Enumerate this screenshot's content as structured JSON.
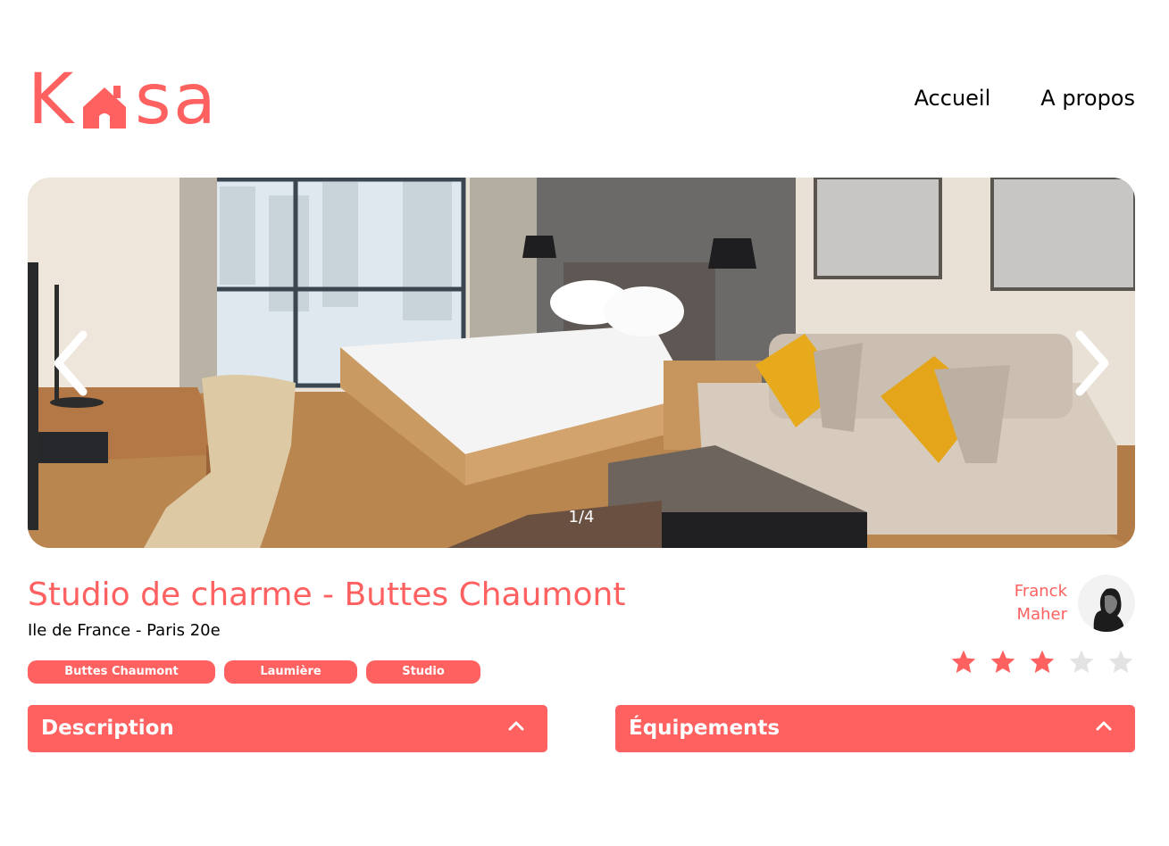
{
  "header": {
    "logo": {
      "text": "Kasa",
      "letters": [
        "K",
        "s",
        "a"
      ],
      "color": "#FF6060"
    },
    "nav": [
      {
        "label": "Accueil"
      },
      {
        "label": "A propos"
      }
    ]
  },
  "gallery": {
    "counter": "1/4",
    "prev_icon": "chevron-left-icon",
    "next_icon": "chevron-right-icon"
  },
  "listing": {
    "title": "Studio de charme - Buttes Chaumont",
    "location": "Ile de France - Paris 20e",
    "tags": [
      "Buttes Chaumont",
      "Laumière",
      "Studio"
    ],
    "host": {
      "first_name": "Franck",
      "last_name": "Maher"
    },
    "rating": {
      "value": 3,
      "max": 5
    },
    "colors": {
      "accent": "#FF6060",
      "star_off": "#E3E3E3"
    }
  },
  "sections": [
    {
      "label": "Description",
      "icon": "chevron-up-icon"
    },
    {
      "label": "Équipements",
      "icon": "chevron-up-icon"
    }
  ]
}
